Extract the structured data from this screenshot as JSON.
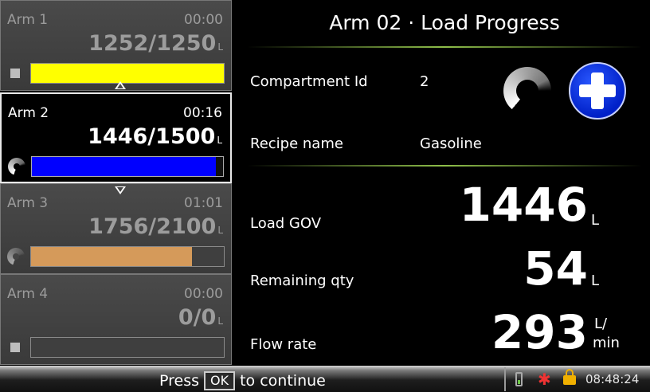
{
  "arms": [
    {
      "name": "Arm 1",
      "time": "00:00",
      "qty": "1252/1250",
      "unit": "L",
      "fill_fraction": 1.0,
      "bar_color": "#ffff00",
      "status_icon": "stop-icon",
      "active": false
    },
    {
      "name": "Arm 2",
      "time": "00:16",
      "qty": "1446/1500",
      "unit": "L",
      "fill_fraction": 0.964,
      "bar_color": "#0000ff",
      "status_icon": "spinner-icon",
      "active": true
    },
    {
      "name": "Arm 3",
      "time": "01:01",
      "qty": "1756/2100",
      "unit": "L",
      "fill_fraction": 0.836,
      "bar_color": "#d59a5a",
      "status_icon": "spinner-icon",
      "active": false
    },
    {
      "name": "Arm 4",
      "time": "00:00",
      "qty": "0/0",
      "unit": "L",
      "fill_fraction": 0,
      "bar_color": "#3f3f3f",
      "status_icon": "stop-icon",
      "active": false
    }
  ],
  "detail": {
    "title": "Arm 02 · Load Progress",
    "compartment_label": "Compartment Id",
    "compartment_value": "2",
    "recipe_label": "Recipe name",
    "recipe_value": "Gasoline",
    "load_gov_label": "Load GOV",
    "load_gov_value": "1446",
    "load_gov_unit": "L",
    "remaining_label": "Remaining qty",
    "remaining_value": "54",
    "remaining_unit": "L",
    "flow_label": "Flow rate",
    "flow_value": "293",
    "flow_unit_top": "L/",
    "flow_unit_bottom": "min"
  },
  "footer": {
    "press": "Press",
    "ok": "OK",
    "continue": "to continue",
    "clock": "08:48:24"
  },
  "colors": {
    "accent_rule": "#8fbf4a",
    "add_button": "#0020c8"
  }
}
